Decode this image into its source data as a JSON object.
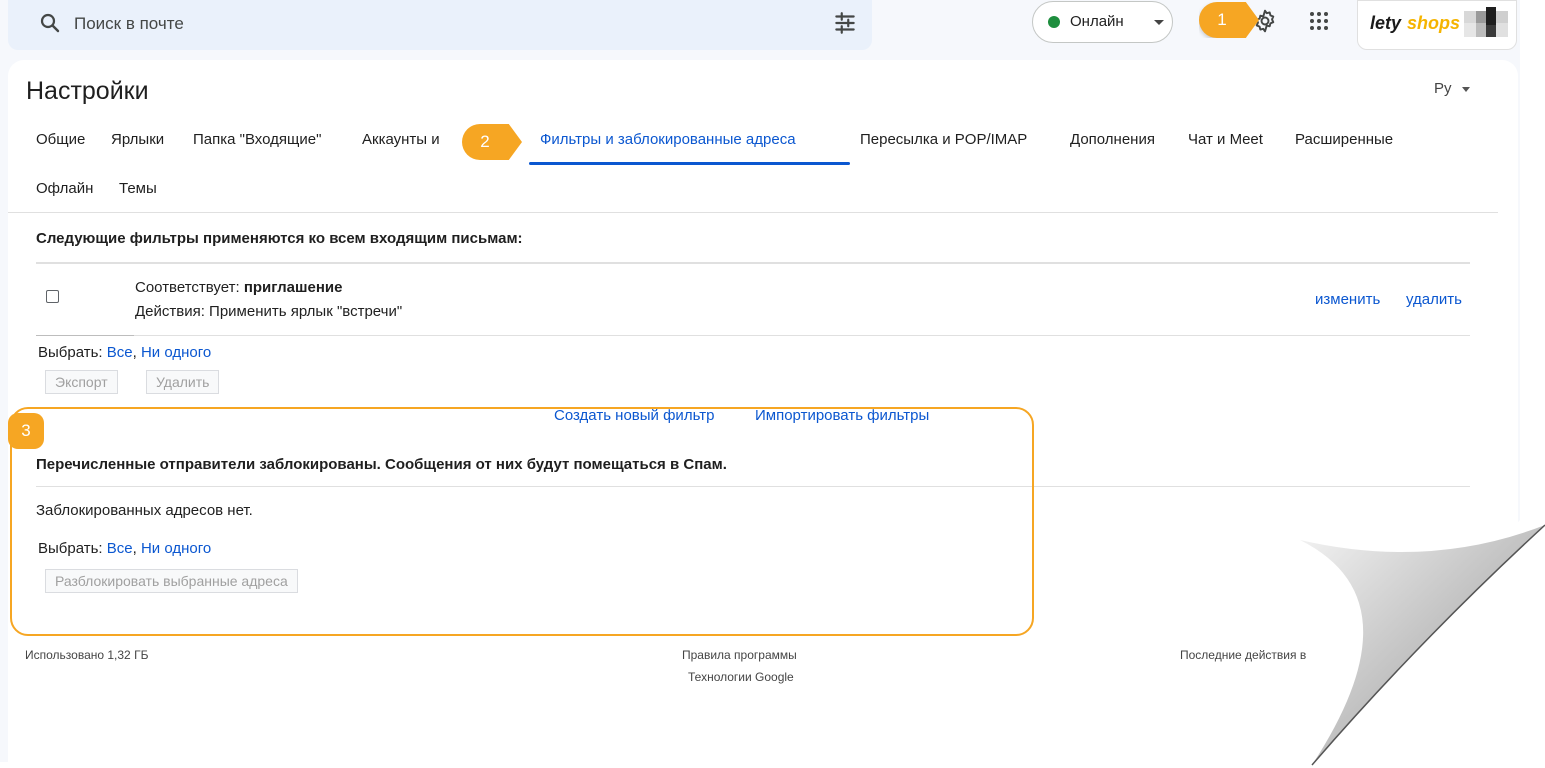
{
  "search": {
    "placeholder": "Поиск в почте"
  },
  "status": {
    "label": "Онлайн",
    "color": "#1e8e3e"
  },
  "brand": {
    "part1": "lety",
    "part2": "shops",
    "accent": "#f5b400"
  },
  "settings": {
    "title": "Настройки",
    "language_short": "Ру",
    "tabs": [
      "Общие",
      "Ярлыки",
      "Папка \"Входящие\"",
      "Аккаунты и",
      "Фильтры и заблокированные адреса",
      "Пересылка и POP/IMAP",
      "Дополнения",
      "Чат и Meet",
      "Расширенные",
      "Офлайн",
      "Темы"
    ],
    "active_tab": "Фильтры и заблокированные адреса"
  },
  "filters": {
    "heading": "Следующие фильтры применяются ко всем входящим письмам:",
    "item": {
      "match_label": "Соответствует:",
      "match_value": "приглашение",
      "action": "Действия: Применить ярлык \"встречи\"",
      "edit": "изменить",
      "delete": "удалить"
    },
    "select_label": "Выбрать:",
    "select_all": "Все",
    "select_none": "Ни одного",
    "export_btn": "Экспорт",
    "delete_btn": "Удалить",
    "create_link": "Создать новый фильтр",
    "import_link": "Импортировать фильтры"
  },
  "blocked": {
    "heading": "Перечисленные отправители заблокированы. Сообщения от них будут помещаться в Спам.",
    "empty": "Заблокированных адресов нет.",
    "select_label": "Выбрать:",
    "select_all": "Все",
    "select_none": "Ни одного",
    "unblock_btn": "Разблокировать выбранные адреса"
  },
  "footer": {
    "used": "Использовано 1,32 ГБ",
    "rules": "Правила программы",
    "tech": "Технологии Google",
    "last": "Последние действия в"
  },
  "annotations": {
    "b1": "1",
    "b2": "2",
    "b3": "3",
    "color": "#f6a623"
  }
}
